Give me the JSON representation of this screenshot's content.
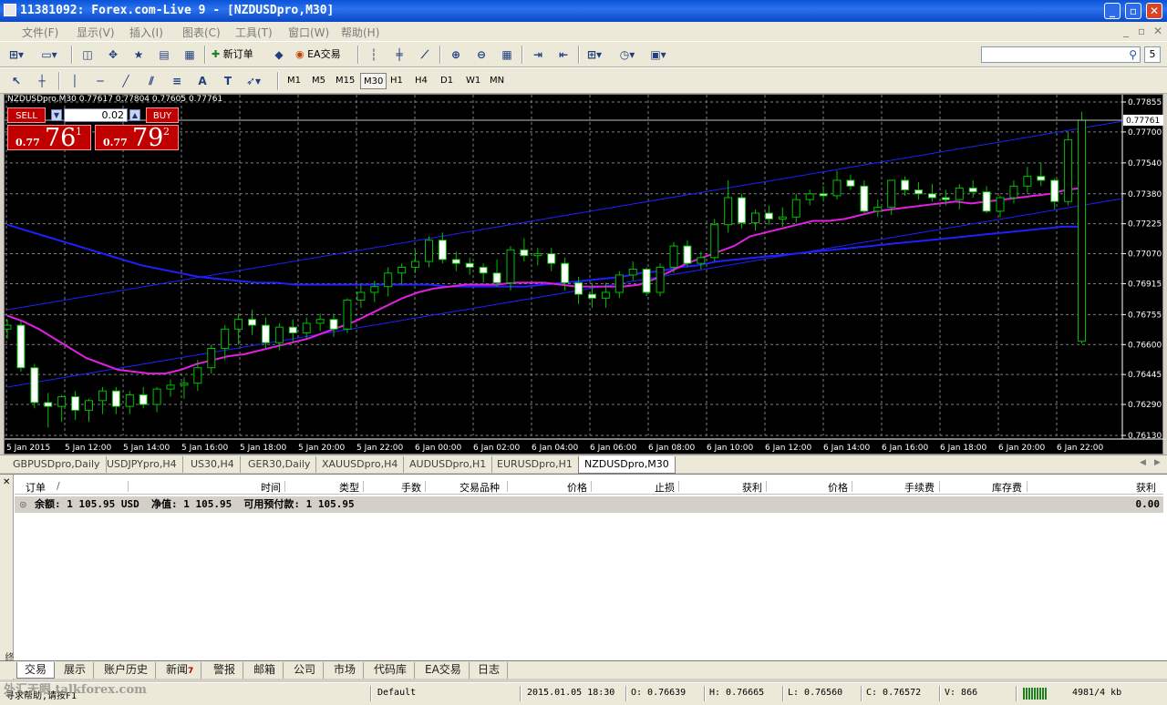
{
  "window": {
    "title": "11381092: Forex.com-Live 9 - [NZDUSDpro,M30]",
    "min": "_",
    "max": "▫",
    "close": "✕"
  },
  "menu": [
    "文件(F)",
    "显示(V)",
    "插入(I)",
    "图表(C)",
    "工具(T)",
    "窗口(W)",
    "帮助(H)"
  ],
  "toolbar": {
    "new_order": "新订单",
    "ea_trading": "EA交易",
    "search_count": "5"
  },
  "timeframes": [
    "M1",
    "M5",
    "M15",
    "M30",
    "H1",
    "H4",
    "D1",
    "W1",
    "MN"
  ],
  "active_timeframe": "M30",
  "one_click": {
    "sell_label": "SELL",
    "buy_label": "BUY",
    "lot": "0.02",
    "sell_prefix": "0.77",
    "sell_big": "76",
    "sell_sup": "1",
    "buy_prefix": "0.77",
    "buy_big": "79",
    "buy_sup": "2"
  },
  "chart_info": "NZDUSDpro,M30  0.77617 0.77804 0.77605 0.77761",
  "chart_data": {
    "type": "candlestick",
    "symbol": "NZDUSDpro",
    "timeframe": "M30",
    "ohlc_last": {
      "open": 0.77617,
      "high": 0.77804,
      "low": 0.77605,
      "close": 0.77761
    },
    "current_price_label": "0.77761",
    "ylim": [
      0.7613,
      0.77855
    ],
    "y_ticks": [
      "0.77855",
      "0.77700",
      "0.77540",
      "0.77380",
      "0.77225",
      "0.77070",
      "0.76915",
      "0.76755",
      "0.76600",
      "0.76445",
      "0.76290",
      "0.76130"
    ],
    "x_ticks": [
      "5 Jan 2015",
      "5 Jan 12:00",
      "5 Jan 14:00",
      "5 Jan 16:00",
      "5 Jan 18:00",
      "5 Jan 20:00",
      "5 Jan 22:00",
      "6 Jan 00:00",
      "6 Jan 02:00",
      "6 Jan 04:00",
      "6 Jan 06:00",
      "6 Jan 08:00",
      "6 Jan 10:00",
      "6 Jan 12:00",
      "6 Jan 14:00",
      "6 Jan 16:00",
      "6 Jan 18:00",
      "6 Jan 20:00",
      "6 Jan 22:00"
    ],
    "candles": [
      [
        0.7668,
        0.7673,
        0.7663,
        0.767
      ],
      [
        0.767,
        0.7672,
        0.7646,
        0.7648
      ],
      [
        0.7648,
        0.765,
        0.7627,
        0.763
      ],
      [
        0.763,
        0.7635,
        0.7617,
        0.7628
      ],
      [
        0.7628,
        0.7634,
        0.762,
        0.7633
      ],
      [
        0.7633,
        0.7636,
        0.7621,
        0.7626
      ],
      [
        0.7626,
        0.7632,
        0.762,
        0.7631
      ],
      [
        0.7631,
        0.7638,
        0.7624,
        0.7636
      ],
      [
        0.7636,
        0.7638,
        0.7624,
        0.7628
      ],
      [
        0.7628,
        0.7636,
        0.7624,
        0.7634
      ],
      [
        0.7634,
        0.7638,
        0.7627,
        0.7629
      ],
      [
        0.7629,
        0.7638,
        0.7625,
        0.7637
      ],
      [
        0.7637,
        0.7642,
        0.7633,
        0.7639
      ],
      [
        0.7639,
        0.7643,
        0.7632,
        0.764
      ],
      [
        0.764,
        0.7652,
        0.7636,
        0.7648
      ],
      [
        0.7648,
        0.766,
        0.7645,
        0.7658
      ],
      [
        0.7658,
        0.767,
        0.7652,
        0.7668
      ],
      [
        0.7668,
        0.7676,
        0.766,
        0.7673
      ],
      [
        0.7673,
        0.7678,
        0.7665,
        0.767
      ],
      [
        0.767,
        0.7674,
        0.7658,
        0.7661
      ],
      [
        0.7661,
        0.7671,
        0.7657,
        0.7669
      ],
      [
        0.7669,
        0.7673,
        0.7661,
        0.7666
      ],
      [
        0.7666,
        0.7674,
        0.7663,
        0.7671
      ],
      [
        0.7671,
        0.7676,
        0.7667,
        0.7673
      ],
      [
        0.7673,
        0.7676,
        0.7664,
        0.7668
      ],
      [
        0.7668,
        0.7684,
        0.7666,
        0.7683
      ],
      [
        0.7683,
        0.7691,
        0.7679,
        0.7687
      ],
      [
        0.7687,
        0.7693,
        0.7682,
        0.769
      ],
      [
        0.769,
        0.77,
        0.7685,
        0.7697
      ],
      [
        0.7697,
        0.7702,
        0.7691,
        0.77
      ],
      [
        0.77,
        0.7709,
        0.7697,
        0.7703
      ],
      [
        0.7703,
        0.7716,
        0.77,
        0.7714
      ],
      [
        0.7714,
        0.7718,
        0.7702,
        0.7704
      ],
      [
        0.7704,
        0.7708,
        0.7698,
        0.7702
      ],
      [
        0.7702,
        0.7705,
        0.7696,
        0.77
      ],
      [
        0.77,
        0.7702,
        0.7692,
        0.7697
      ],
      [
        0.7697,
        0.7704,
        0.769,
        0.7692
      ],
      [
        0.7692,
        0.7711,
        0.7688,
        0.7709
      ],
      [
        0.7709,
        0.7715,
        0.7703,
        0.7706
      ],
      [
        0.7706,
        0.771,
        0.7701,
        0.7707
      ],
      [
        0.7707,
        0.771,
        0.7698,
        0.7702
      ],
      [
        0.7702,
        0.7705,
        0.7688,
        0.7692
      ],
      [
        0.7692,
        0.7695,
        0.7681,
        0.7686
      ],
      [
        0.7686,
        0.7692,
        0.7679,
        0.7684
      ],
      [
        0.7684,
        0.7692,
        0.7679,
        0.7687
      ],
      [
        0.7687,
        0.7698,
        0.7684,
        0.7696
      ],
      [
        0.7696,
        0.7703,
        0.7693,
        0.7699
      ],
      [
        0.7699,
        0.77,
        0.7685,
        0.7687
      ],
      [
        0.7687,
        0.7702,
        0.7685,
        0.77
      ],
      [
        0.77,
        0.7713,
        0.7697,
        0.7711
      ],
      [
        0.7711,
        0.7714,
        0.77,
        0.7702
      ],
      [
        0.7702,
        0.7708,
        0.7699,
        0.7705
      ],
      [
        0.7705,
        0.7725,
        0.7703,
        0.7722
      ],
      [
        0.7722,
        0.7745,
        0.7718,
        0.7736
      ],
      [
        0.7736,
        0.7738,
        0.772,
        0.7723
      ],
      [
        0.7723,
        0.773,
        0.7719,
        0.7728
      ],
      [
        0.7728,
        0.7732,
        0.7722,
        0.7725
      ],
      [
        0.7725,
        0.7731,
        0.7721,
        0.7726
      ],
      [
        0.7726,
        0.7738,
        0.7723,
        0.7735
      ],
      [
        0.7735,
        0.774,
        0.7732,
        0.7738
      ],
      [
        0.7738,
        0.7742,
        0.7734,
        0.7737
      ],
      [
        0.7737,
        0.775,
        0.7735,
        0.7745
      ],
      [
        0.7745,
        0.7748,
        0.774,
        0.7742
      ],
      [
        0.7742,
        0.7745,
        0.7728,
        0.7729
      ],
      [
        0.7729,
        0.7735,
        0.7726,
        0.7731
      ],
      [
        0.7731,
        0.7745,
        0.7727,
        0.7745
      ],
      [
        0.7745,
        0.7747,
        0.7737,
        0.774
      ],
      [
        0.774,
        0.7744,
        0.7735,
        0.7738
      ],
      [
        0.7738,
        0.7743,
        0.7734,
        0.7736
      ],
      [
        0.7736,
        0.774,
        0.7732,
        0.7735
      ],
      [
        0.7735,
        0.7743,
        0.773,
        0.7741
      ],
      [
        0.7741,
        0.7745,
        0.7736,
        0.7739
      ],
      [
        0.7739,
        0.7742,
        0.7728,
        0.7729
      ],
      [
        0.7729,
        0.7737,
        0.7726,
        0.7736
      ],
      [
        0.7736,
        0.7745,
        0.7733,
        0.7742
      ],
      [
        0.7742,
        0.7752,
        0.7738,
        0.7747
      ],
      [
        0.7747,
        0.7754,
        0.7742,
        0.7745
      ],
      [
        0.7745,
        0.7746,
        0.773,
        0.7734
      ],
      [
        0.7734,
        0.777,
        0.7732,
        0.7766
      ],
      [
        0.76617,
        0.77804,
        0.76605,
        0.77761
      ]
    ],
    "ma_fast": [
      0.7675,
      0.7672,
      0.7668,
      0.7663,
      0.7658,
      0.7653,
      0.765,
      0.7647,
      0.7646,
      0.7645,
      0.7645,
      0.7647,
      0.765,
      0.7652,
      0.7654,
      0.7655,
      0.7657,
      0.7659,
      0.7661,
      0.7663,
      0.7666,
      0.7669,
      0.7672,
      0.7676,
      0.768,
      0.7684,
      0.7687,
      0.7689,
      0.769,
      0.7691,
      0.7691,
      0.7691,
      0.7692,
      0.7692,
      0.7692,
      0.7691,
      0.769,
      0.769,
      0.769,
      0.769,
      0.7691,
      0.7694,
      0.7698,
      0.7702,
      0.7705,
      0.7708,
      0.7711,
      0.7716,
      0.7718,
      0.772,
      0.7722,
      0.7724,
      0.7724,
      0.7725,
      0.7727,
      0.7729,
      0.773,
      0.7731,
      0.7732,
      0.7733,
      0.7734,
      0.7733,
      0.7734,
      0.7735,
      0.7736,
      0.7737,
      0.7738,
      0.774,
      0.7741
    ],
    "ma_slow": [
      0.7722,
      0.7719,
      0.7716,
      0.7713,
      0.771,
      0.7707,
      0.7704,
      0.7701,
      0.7699,
      0.7697,
      0.7695,
      0.7694,
      0.7693,
      0.7692,
      0.7692,
      0.7691,
      0.7691,
      0.7691,
      0.7691,
      0.7691,
      0.7691,
      0.7691,
      0.7691,
      0.769,
      0.769,
      0.769,
      0.769,
      0.769,
      0.7691,
      0.7692,
      0.7693,
      0.7694,
      0.7695,
      0.7697,
      0.7698,
      0.77,
      0.7701,
      0.7703,
      0.7704,
      0.7705,
      0.7706,
      0.7707,
      0.7708,
      0.7709,
      0.771,
      0.7711,
      0.7712,
      0.7713,
      0.7714,
      0.7715,
      0.7716,
      0.7717,
      0.7718,
      0.7719,
      0.772,
      0.7721,
      0.7721
    ],
    "colors": {
      "background": "#000000",
      "grid": "#808080",
      "bull": "#ffffff",
      "bear": "#ffffff",
      "wick": "#00c000",
      "ma_fast": "#e020e0",
      "ma_slow": "#2020ff",
      "channel": "#2020ff",
      "axis_text": "#ffffff"
    }
  },
  "chart_tabs": [
    "GBPUSDpro,Daily",
    "USDJPYpro,H4",
    "US30,H4",
    "GER30,Daily",
    "XAUUSDpro,H4",
    "AUDUSDpro,H1",
    "EURUSDpro,H1",
    "NZDUSDpro,M30"
  ],
  "active_chart_tab": "NZDUSDpro,M30",
  "terminal": {
    "side_label": "终端",
    "columns": [
      "订单",
      "/",
      "时间",
      "类型",
      "手数",
      "交易品种",
      "价格",
      "止损",
      "获利",
      "价格",
      "手续费",
      "库存费",
      "获利"
    ],
    "balance_text": "余额: 1 105.95 USD  净值: 1 105.95  可用预付款: 1 105.95",
    "balance_profit": "0.00",
    "tabs": [
      "交易",
      "展示",
      "账户历史",
      "新闻",
      "警报",
      "邮箱",
      "公司",
      "市场",
      "代码库",
      "EA交易",
      "日志"
    ],
    "news_badge": "7",
    "active_tab": "交易"
  },
  "status": {
    "help": "寻求帮助,请按F1",
    "profile": "Default",
    "datetime": "2015.01.05 18:30",
    "open": "O: 0.76639",
    "high": "H: 0.76665",
    "low": "L: 0.76560",
    "close": "C: 0.76572",
    "volume": "V: 866",
    "traffic": "4981/4 kb"
  },
  "watermark": "外汇天眼 talkforex.com"
}
